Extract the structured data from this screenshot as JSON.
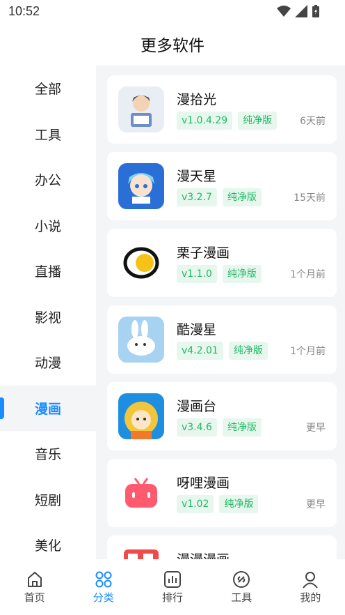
{
  "status": {
    "time": "10:52"
  },
  "header": {
    "title": "更多软件"
  },
  "sidebar": {
    "items": [
      {
        "label": "全部",
        "active": false
      },
      {
        "label": "工具",
        "active": false
      },
      {
        "label": "办公",
        "active": false
      },
      {
        "label": "小说",
        "active": false
      },
      {
        "label": "直播",
        "active": false
      },
      {
        "label": "影视",
        "active": false
      },
      {
        "label": "动漫",
        "active": false
      },
      {
        "label": "漫画",
        "active": true
      },
      {
        "label": "音乐",
        "active": false
      },
      {
        "label": "短剧",
        "active": false
      },
      {
        "label": "美化",
        "active": false
      }
    ]
  },
  "apps": [
    {
      "name": "漫拾光",
      "version": "v1.0.4.29",
      "tag": "纯净版",
      "time": "6天前",
      "icon": "boy-reading-icon"
    },
    {
      "name": "漫天星",
      "version": "v3.2.7",
      "tag": "纯净版",
      "time": "15天前",
      "icon": "anime-girl-icon"
    },
    {
      "name": "栗子漫画",
      "version": "v1.1.0",
      "tag": "纯净版",
      "time": "1个月前",
      "icon": "egg-icon"
    },
    {
      "name": "酷漫星",
      "version": "v4.2.01",
      "tag": "纯净版",
      "time": "1个月前",
      "icon": "rabbit-icon"
    },
    {
      "name": "漫画台",
      "version": "v3.4.6",
      "tag": "纯净版",
      "time": "更早",
      "icon": "lion-character-icon"
    },
    {
      "name": "呀哩漫画",
      "version": "v1.02",
      "tag": "纯净版",
      "time": "更早",
      "icon": "tv-icon"
    },
    {
      "name": "漫漫漫画",
      "version": "",
      "tag": "",
      "time": "",
      "icon": "book-icon"
    }
  ],
  "bottom_nav": [
    {
      "label": "首页",
      "icon": "home-icon",
      "active": false
    },
    {
      "label": "分类",
      "icon": "category-icon",
      "active": true
    },
    {
      "label": "排行",
      "icon": "ranking-icon",
      "active": false
    },
    {
      "label": "工具",
      "icon": "tools-icon",
      "active": false
    },
    {
      "label": "我的",
      "icon": "profile-icon",
      "active": false
    }
  ],
  "colors": {
    "accent": "#1a8cff",
    "tag_bg": "#e7f7ee",
    "tag_text": "#21b865"
  }
}
